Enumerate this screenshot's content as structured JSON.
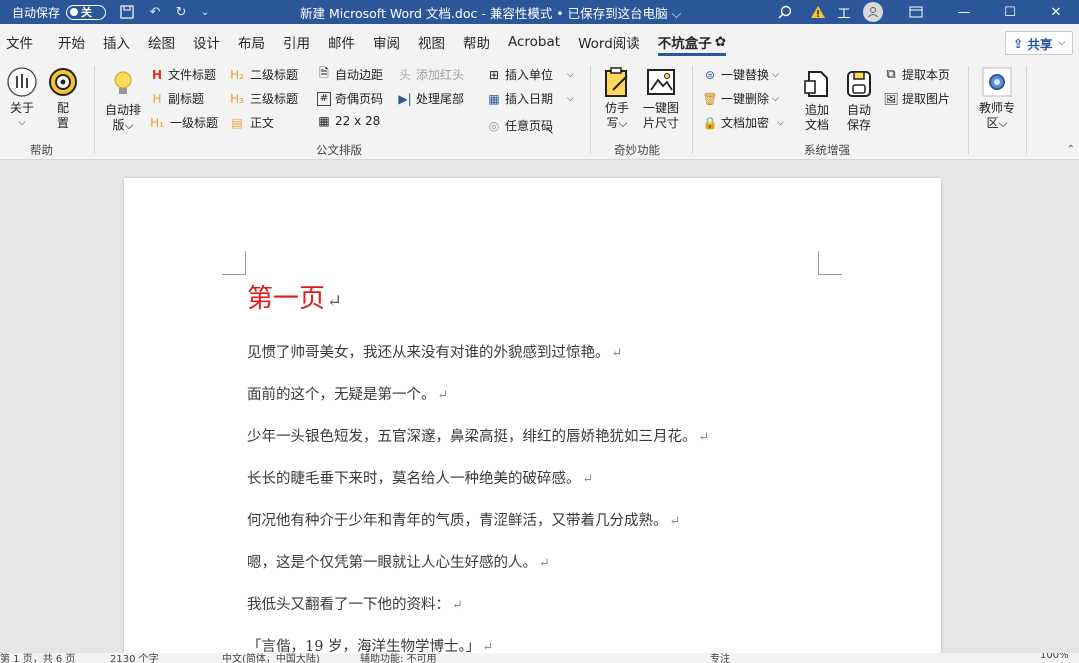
{
  "titlebar": {
    "autosave_label": "自动保存",
    "autosave_state": "关",
    "doc_title": "新建 Microsoft Word 文档.doc  -  兼容性模式 • 已保存到这台电脑 ⌵",
    "warning_label": "工"
  },
  "tabs": [
    "文件",
    "开始",
    "插入",
    "绘图",
    "设计",
    "布局",
    "引用",
    "邮件",
    "审阅",
    "视图",
    "帮助",
    "Acrobat",
    "Word阅读",
    "不坑盒子"
  ],
  "share_label": "共享",
  "ribbon": {
    "help_group": {
      "label": "帮助",
      "about": "关于",
      "about_arrow": "⌵",
      "config_1": "配",
      "config_2": "置"
    },
    "layout_group": {
      "label": "公文排版",
      "auto_layout_1": "自动排",
      "auto_layout_2": "版⌵",
      "doc_title": "文件标题",
      "sub_title": "副标题",
      "h1": "一级标题",
      "h2": "二级标题",
      "h3": "三级标题",
      "body": "正文",
      "auto_margin": "自动边距",
      "odd_even_page": "奇偶页码",
      "grid": "22 x 28",
      "add_header": "添加红头",
      "process_tail": "处理尾部",
      "insert_unit": "插入单位",
      "insert_date": "插入日期",
      "any_page_no": "任意页码"
    },
    "magic_group": {
      "label": "奇妙功能",
      "imitate_1": "仿手",
      "imitate_2": "写⌵",
      "img_size_1": "一键图",
      "img_size_2": "片尺寸"
    },
    "system_group": {
      "label": "系统增强",
      "replace": "一键替换",
      "delete": "一键删除",
      "encrypt": "文档加密",
      "append_1": "追加",
      "append_2": "文档",
      "autosave_1": "自动",
      "autosave_2": "保存",
      "extract_page": "提取本页",
      "extract_img": "提取图片"
    },
    "teacher_group": {
      "label_1": "教师专",
      "label_2": "区⌵"
    }
  },
  "document": {
    "heading": "第一页",
    "paragraphs": [
      "见惯了帅哥美女，我还从来没有对谁的外貌感到过惊艳。",
      "面前的这个，无疑是第一个。",
      "少年一头银色短发，五官深邃，鼻梁高挺，绯红的唇娇艳犹如三月花。",
      "长长的睫毛垂下来时，莫名给人一种绝美的破碎感。",
      "何况他有种介于少年和青年的气质，青涩鲜活，又带着几分成熟。",
      "嗯，这是个仅凭第一眼就让人心生好感的人。",
      "我低头又翻看了一下他的资料：",
      "「言偕，19 岁，海洋生物学博士。」"
    ]
  },
  "statusbar": {
    "page_info": "第 1 页，共 6 页",
    "word_count": "2130 个字",
    "lang": "中文(简体，中国大陆)",
    "accessibility": "辅助功能: 不可用",
    "focus": "专注",
    "zoom": "100%"
  },
  "colors": {
    "title_bar": "#2b579a",
    "heading_red": "#e01b1b"
  }
}
